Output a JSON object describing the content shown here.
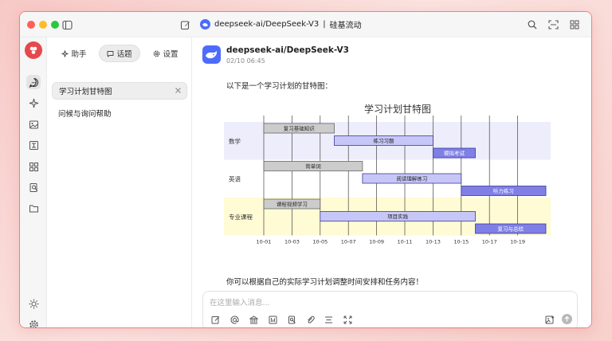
{
  "window": {
    "title_model": "deepseek-ai/DeepSeek-V3",
    "title_sep": "|",
    "title_provider": "硅基流动"
  },
  "panel": {
    "tabs": [
      {
        "label": "助手",
        "icon": "sparkle-icon"
      },
      {
        "label": "话题",
        "icon": "chat-icon",
        "active": true
      },
      {
        "label": "设置",
        "icon": "gear-icon"
      }
    ],
    "topics": [
      {
        "label": "学习计划甘特图",
        "active": true
      },
      {
        "label": "问候与询问帮助"
      }
    ]
  },
  "message": {
    "sender": "deepseek-ai/DeepSeek-V3",
    "time": "02/10 06:45",
    "intro": "以下是一个学习计划的甘特图：",
    "outro": "你可以根据自己的实际学习计划调整时间安排和任务内容！"
  },
  "chart_data": {
    "type": "gantt",
    "title": "学习计划甘特图",
    "x_ticks": [
      "10-01",
      "10-03",
      "10-05",
      "10-07",
      "10-09",
      "10-11",
      "10-13",
      "10-15",
      "10-17",
      "10-19"
    ],
    "sections": [
      {
        "name": "数学",
        "band_color": "#ededfb",
        "tasks": [
          {
            "name": "复习基础知识",
            "start": "10-01",
            "end": "10-05",
            "style": "done"
          },
          {
            "name": "练习习题",
            "start": "10-06",
            "end": "10-12",
            "style": "active"
          },
          {
            "name": "模拟考试",
            "start": "10-13",
            "end": "10-15",
            "style": "planned"
          }
        ]
      },
      {
        "name": "英语",
        "band_color": "#ffffff",
        "tasks": [
          {
            "name": "背单词",
            "start": "10-01",
            "end": "10-07",
            "style": "done"
          },
          {
            "name": "阅读理解练习",
            "start": "10-08",
            "end": "10-14",
            "style": "active"
          },
          {
            "name": "听力练习",
            "start": "10-15",
            "end": "10-20",
            "style": "planned"
          }
        ]
      },
      {
        "name": "专业课程",
        "band_color": "#fefbd5",
        "tasks": [
          {
            "name": "课程视频学习",
            "start": "10-01",
            "end": "10-04",
            "style": "done"
          },
          {
            "name": "项目实践",
            "start": "10-05",
            "end": "10-15",
            "style": "active"
          },
          {
            "name": "复习与总结",
            "start": "10-16",
            "end": "10-20",
            "style": "planned"
          }
        ]
      }
    ],
    "grid": true
  },
  "input": {
    "placeholder": "在这里输入消息..."
  },
  "colors": {
    "accent": "#e5484d",
    "done_fill": "#cccccc",
    "active_fill": "#c7c7f7",
    "planned_fill": "#7f7fe6",
    "bar_stroke": "#3a3a9a"
  }
}
